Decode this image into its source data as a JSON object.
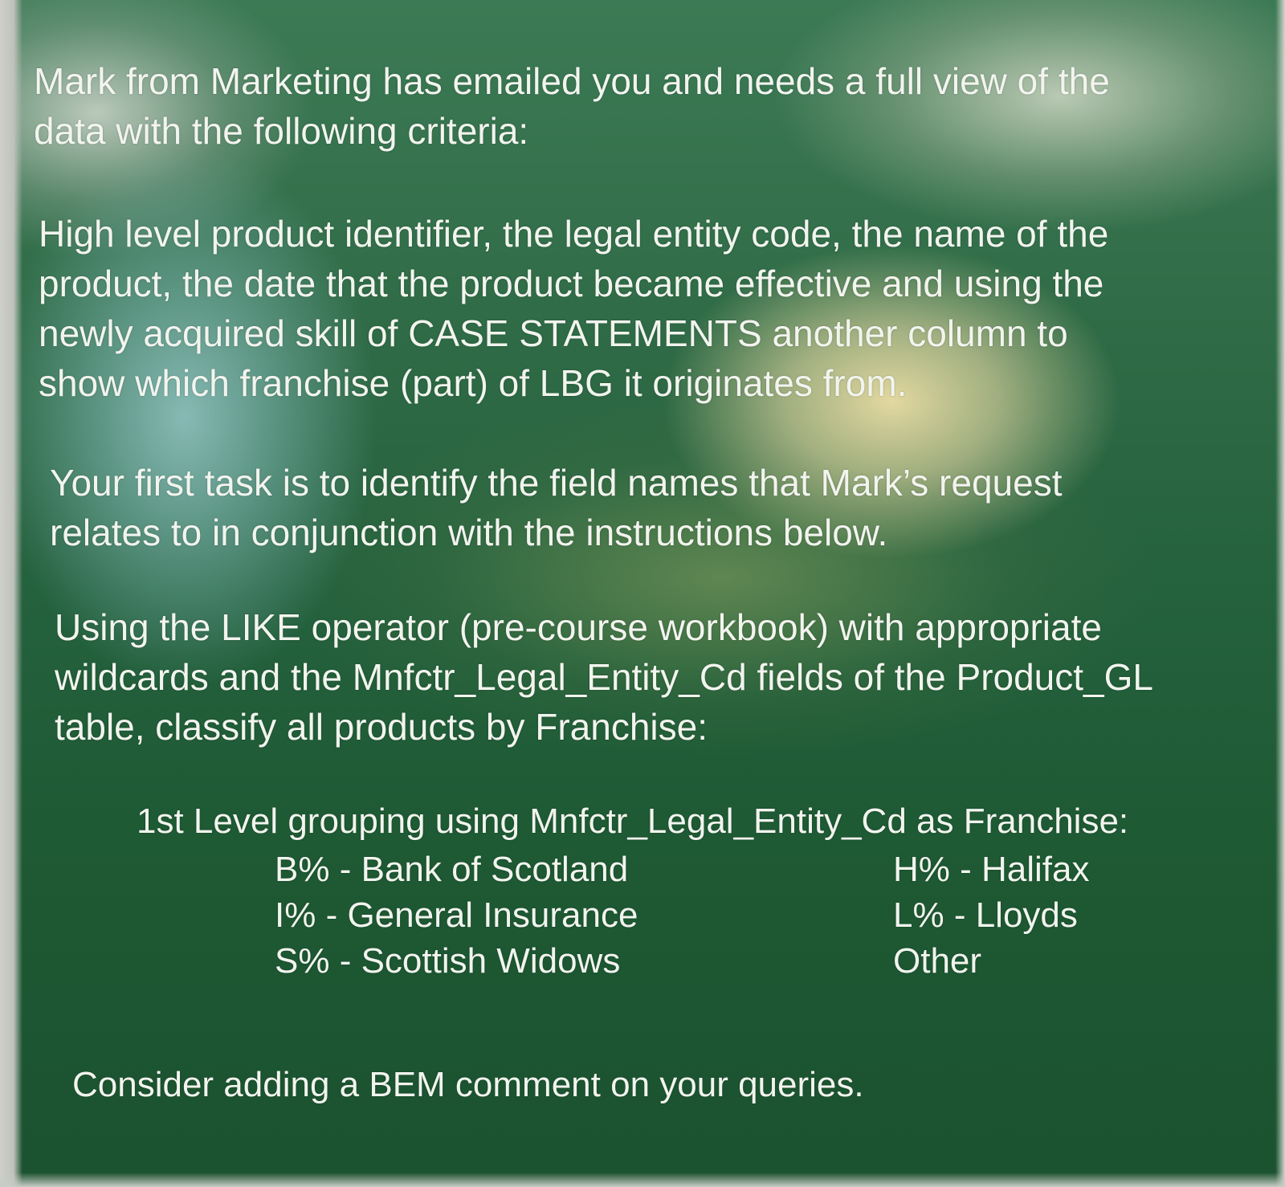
{
  "slide": {
    "paragraph1": [
      "Mark from Marketing has emailed you and needs a full view of the",
      "data with the following criteria:"
    ],
    "paragraph2": [
      "High level product identifier, the legal entity code, the name of the",
      "product, the date that the product became effective and using the",
      "newly acquired skill of CASE STATEMENTS another column to",
      "show which franchise (part) of LBG it originates from."
    ],
    "paragraph3": [
      "Your first task is to identify the field names that Mark’s request",
      "relates to in conjunction with the instructions below."
    ],
    "paragraph4": [
      "Using the LIKE operator (pre-course workbook) with appropriate",
      "wildcards and the Mnfctr_Legal_Entity_Cd fields of the Product_GL",
      "table, classify all products by Franchise:"
    ],
    "grouping_heading": "1st Level grouping using Mnfctr_Legal_Entity_Cd as Franchise:",
    "franchise_left": [
      "B% - Bank of Scotland",
      "I% - General Insurance",
      "S% - Scottish Widows"
    ],
    "franchise_right": [
      "H% - Halifax",
      "L% - Lloyds",
      "Other"
    ],
    "closing_note": "Consider adding a BEM comment on your queries."
  },
  "colors": {
    "text": "#f2f4ee",
    "background_green": "#24613d"
  }
}
